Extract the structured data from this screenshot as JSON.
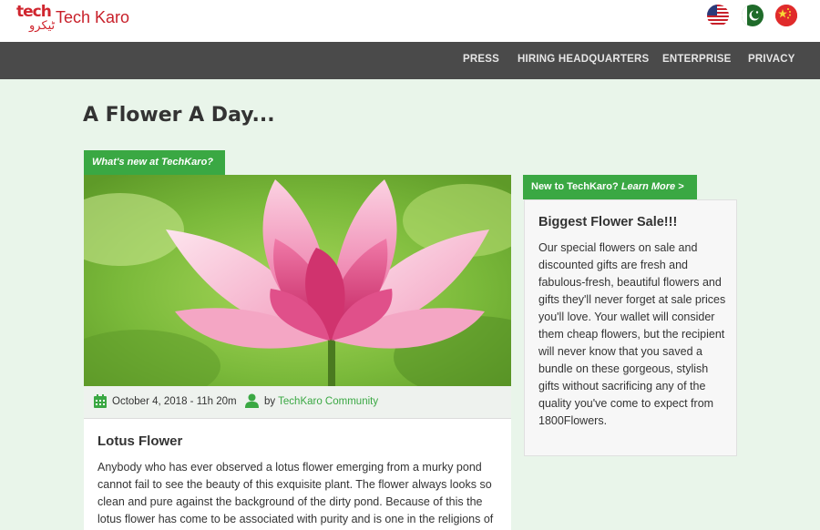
{
  "brand": {
    "logo_text": "tech",
    "logo_script": "ٹیکرو",
    "name": "Tech Karo"
  },
  "flags": [
    {
      "name": "United States",
      "icon": "us-flag-icon"
    },
    {
      "name": "Pakistan",
      "icon": "pk-flag-icon"
    },
    {
      "name": "China",
      "icon": "cn-flag-icon"
    }
  ],
  "nav": {
    "items": [
      {
        "label": "PRESS"
      },
      {
        "label": "HIRING HEADQUARTERS"
      },
      {
        "label": "ENTERPRISE"
      },
      {
        "label": "PRIVACY"
      }
    ]
  },
  "page": {
    "title": "A Flower A Day..."
  },
  "feature": {
    "tag_label": "What's new at TechKaro?",
    "date": "October 4, 2018 - 11h 20m",
    "by_label": "by",
    "author": "TechKaro Community",
    "article_title": "Lotus Flower",
    "article_body": "Anybody who has ever observed a lotus flower emerging from a murky pond cannot fail to see the beauty of this exquisite plant. The flower always looks so clean and pure against the background of the dirty pond. Because of this the lotus flower has come to be associated with purity and is one in the religions of Buddhism and Hinduism."
  },
  "sidebar": {
    "tag_bold": "New to TechKaro?",
    "tag_link": "Learn More >",
    "sale_title": "Biggest Flower Sale!!!",
    "sale_body": "Our special flowers on sale and discounted gifts are fresh and fabulous-fresh, beautiful flowers and gifts they'll never forget at sale prices you'll love. Your wallet will consider them cheap flowers, but the recipient will never know that you saved a bundle on these gorgeous, stylish gifts without sacrificing any of the quality you've come to expect from 1800Flowers."
  },
  "colors": {
    "accent_green": "#3aa843",
    "brand_red": "#c8202a",
    "nav_bg": "#4a4a4a",
    "page_bg": "#e9f5ea"
  }
}
